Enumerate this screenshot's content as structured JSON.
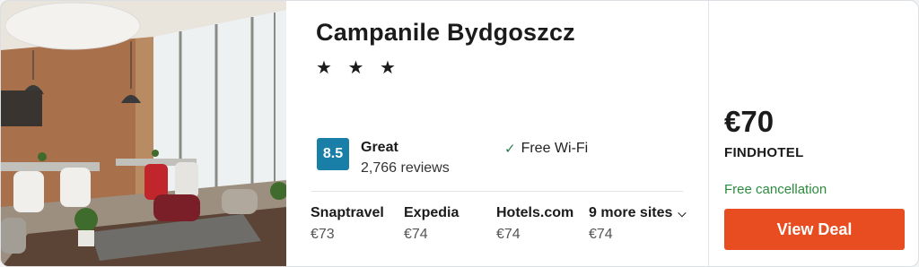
{
  "hotel": {
    "name": "Campanile Bydgoszcz",
    "stars": "★ ★ ★",
    "rating": {
      "score": "8.5",
      "label": "Great",
      "reviews": "2,766 reviews"
    },
    "amenity": {
      "icon": "check-icon",
      "label": "Free Wi-Fi"
    }
  },
  "deals": [
    {
      "site": "Snaptravel",
      "price": "€73"
    },
    {
      "site": "Expedia",
      "price": "€74"
    },
    {
      "site": "Hotels.com",
      "price": "€74"
    },
    {
      "site": "9 more sites",
      "price": "€74",
      "icon": "chevron-down-icon"
    }
  ],
  "offer": {
    "price": "€70",
    "provider": "FINDHOTEL",
    "cancellation": "Free cancellation",
    "button": "View Deal"
  },
  "colors": {
    "rating_badge": "#1a7fa6",
    "button": "#e84d22",
    "free_cancellation": "#2c8a3e"
  }
}
